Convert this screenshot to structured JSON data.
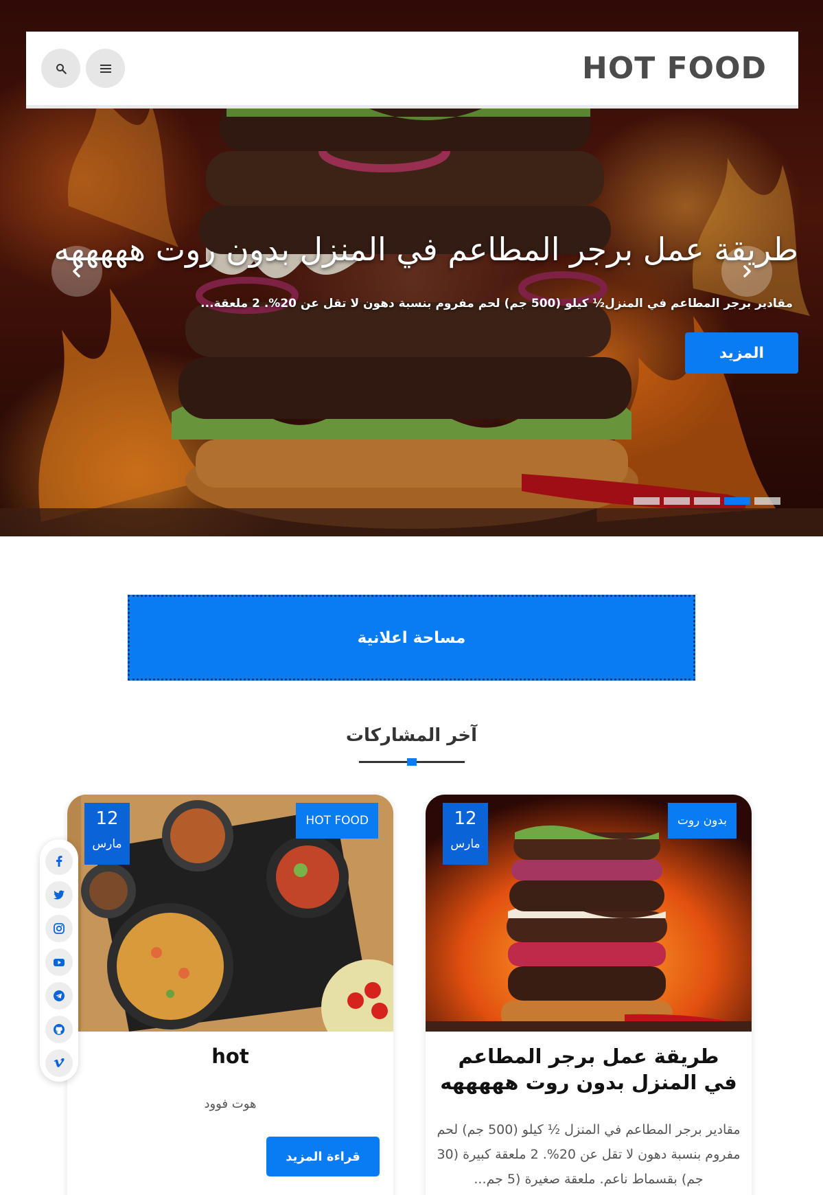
{
  "header": {
    "logo": "HOT FOOD",
    "search_icon": "search-icon",
    "menu_icon": "menu-icon"
  },
  "slider": {
    "title": "طريقة عمل برجر المطاعم في المنزل بدون روت هههههه",
    "description": "مقادير برجر المطاعم في المنزل½ كيلو (500 جم) لحم مفروم بنسبة دهون لا تقل عن 20%. 2 ملعقة...",
    "more_label": "المزيد",
    "slide_count": 5,
    "active_slide": 4
  },
  "ad": {
    "label": "مساحة اعلانية"
  },
  "latest": {
    "title": "آخر المشاركات"
  },
  "posts": [
    {
      "day": "12",
      "month": "مارس",
      "tag": "بدون روت",
      "title": "طريقة عمل برجر المطاعم في المنزل بدون روت هههههه",
      "excerpt": "مقادير برجر المطاعم في المنزل ½ كيلو (500 جم) لحم مفروم بنسبة دهون لا تقل عن 20%.  2 ملعقة كبيرة (30 جم) بقسماط ناعم.  ملعقة صغيرة (5 جم..."
    },
    {
      "day": "12",
      "month": "مارس",
      "tag": "HOT FOOD",
      "title": "hot",
      "excerpt": "هوت فوود",
      "read_more": "قراءة المزيد"
    }
  ],
  "social": [
    "facebook-icon",
    "twitter-icon",
    "instagram-icon",
    "youtube-icon",
    "telegram-icon",
    "github-icon",
    "vimeo-icon"
  ],
  "colors": {
    "accent": "#0a7cf3",
    "date_badge": "#0a64d8"
  }
}
